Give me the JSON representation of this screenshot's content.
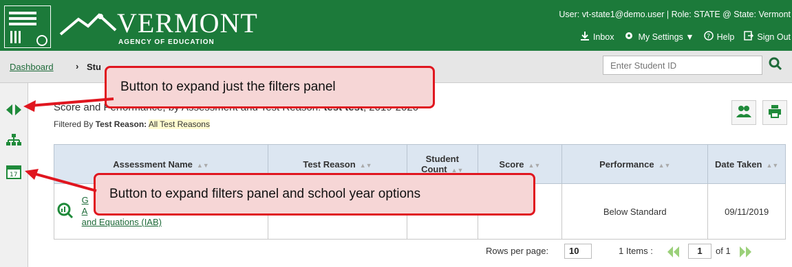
{
  "header": {
    "logo_title": "VERMONT",
    "logo_subtitle": "AGENCY OF EDUCATION",
    "user_line": "User: vt-state1@demo.user  |  Role: STATE @ State: Vermont",
    "nav": {
      "inbox": "Inbox",
      "settings": "My Settings ▼",
      "help": "Help",
      "signout": "Sign Out"
    }
  },
  "breadcrumb": {
    "home": "Dashboard",
    "separator": "›",
    "current": "Stu"
  },
  "search": {
    "placeholder": "Enter Student ID"
  },
  "report": {
    "title_prefix": "Score and Performance, by Assessment and Test Reason: ",
    "student": "test test",
    "year": ", 2019-2020",
    "filtered_label": "Filtered By ",
    "filter_key": "Test Reason:",
    "filter_value": "All Test Reasons"
  },
  "table": {
    "headers": [
      "Assessment Name",
      "Test Reason",
      "Student Count",
      "Score",
      "Performance",
      "Date Taken"
    ],
    "row": {
      "assessment_line1": "G",
      "assessment_line2": "A",
      "assessment_line3": "and Equations (IAB)",
      "performance": "Below Standard",
      "date": "09/11/2019"
    }
  },
  "pager": {
    "rows_label": "Rows per page:",
    "rows_value": "10",
    "items": "1 Items :",
    "page": "1",
    "of": "of 1"
  },
  "callouts": {
    "top": "Button to expand just the filters panel",
    "bottom": "Button to expand filters panel and school year options"
  },
  "colors": {
    "header_green": "#1c7a3a",
    "callout_red": "#e0161f",
    "table_header": "#dce6f1"
  }
}
